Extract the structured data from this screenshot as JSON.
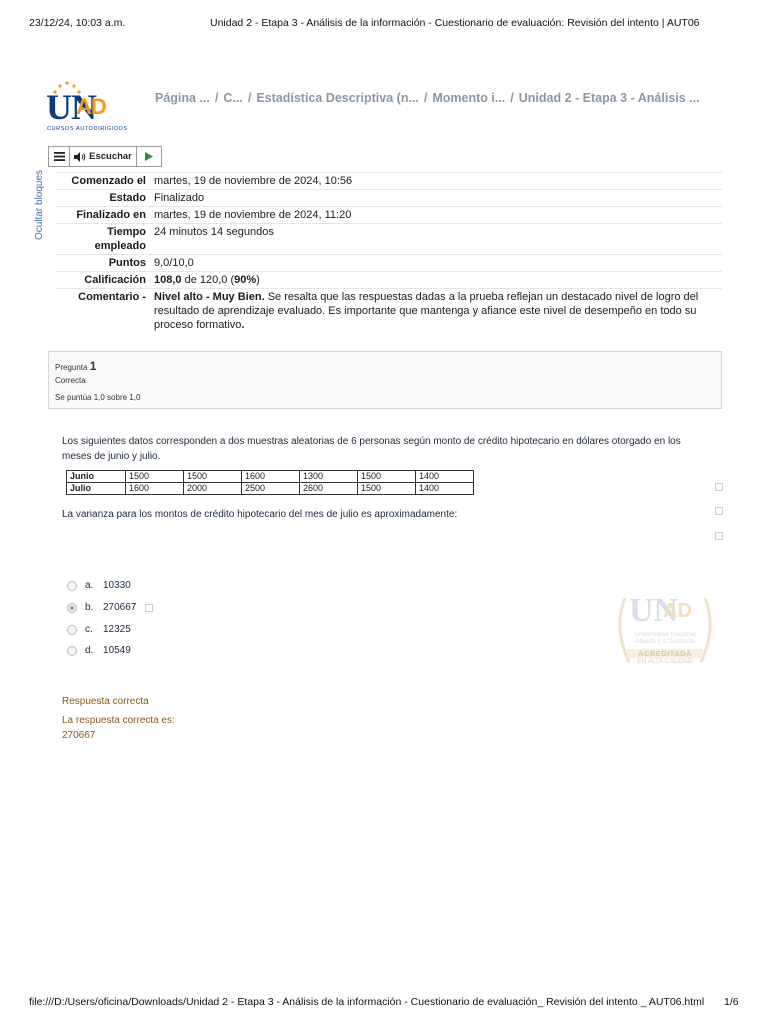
{
  "print_header": {
    "datetime": "23/12/24, 10:03 a.m.",
    "title": "Unidad 2 - Etapa 3 - Análisis de la información - Cuestionario de evaluación: Revisión del intento | AUT06"
  },
  "logo": {
    "mark_main": "UN",
    "mark_accent": "AD",
    "tagline": "CURSOS AUTODIRIGIDOS"
  },
  "breadcrumb": {
    "separator": "/",
    "items": [
      "Página ...",
      "C...",
      "Estadística Descriptiva (n...",
      "Momento i...",
      "Unidad 2 - Etapa 3 - Análisis ..."
    ]
  },
  "toolbar": {
    "menu_icon": "menu-icon",
    "listen_label": "Escuchar",
    "speaker_icon": "speaker-icon",
    "play_icon": "play-icon"
  },
  "side_label": "Ocultar bloques",
  "summary": {
    "started_label": "Comenzado el",
    "started_value": "martes, 19 de noviembre de 2024, 10:56",
    "state_label": "Estado",
    "state_value": "Finalizado",
    "finished_label": "Finalizado en",
    "finished_value": "martes, 19 de noviembre de 2024, 11:20",
    "time_label_1": "Tiempo",
    "time_label_2": "empleado",
    "time_value": "24 minutos 14 segundos",
    "points_label": "Puntos",
    "points_value": "9,0/10,0",
    "grade_label": "Calificación",
    "grade_score": "108,0",
    "grade_of": "de 120,0 (",
    "grade_pct": "90%",
    "grade_close": ")",
    "comment_label": "Comentario -",
    "comment_bold": "Nivel alto - Muy Bien.",
    "comment_text": "Se resalta que las respuestas dadas a la prueba reflejan un destacado nivel de logro del resultado de aprendizaje evaluado. Es importante que mantenga y afiance este nivel de desempeño en todo su proceso formativo",
    "comment_end": "."
  },
  "question": {
    "label": "Pregunta",
    "number": "1",
    "status": "Correcta",
    "score": "Se puntúa 1,0 sobre 1,0",
    "text": "Los siguientes datos corresponden a dos muestras aleatorias de 6 personas según monto de crédito hipotecario en dólares otorgado en los meses de junio y julio.",
    "table": {
      "rows": [
        {
          "label": "Junio",
          "values": [
            "1500",
            "1500",
            "1600",
            "1300",
            "1500",
            "1400"
          ]
        },
        {
          "label": "Julio",
          "values": [
            "1600",
            "2000",
            "2500",
            "2600",
            "1500",
            "1400"
          ]
        }
      ]
    },
    "prompt": "La varianza para los montos de crédito hipotecario del mes de julio es aproximadamente:",
    "options": [
      {
        "letter": "a.",
        "value": "10330",
        "selected": false
      },
      {
        "letter": "b.",
        "value": "270667",
        "selected": true
      },
      {
        "letter": "c.",
        "value": "12325",
        "selected": false
      },
      {
        "letter": "d.",
        "value": "10549",
        "selected": false
      }
    ]
  },
  "watermark": {
    "mark_main": "UN",
    "mark_accent": "AD",
    "line1": "Universidad Nacional",
    "line2": "Abierta y a Distancia",
    "line3": "ACREDITADA",
    "line4": "EN ALTA CALIDAD"
  },
  "feedback": {
    "result": "Respuesta correcta",
    "correct_label": "La respuesta correcta es:",
    "correct_value": "270667"
  },
  "print_footer": {
    "path": "file:///D:/Users/oficina/Downloads/Unidad 2 - Etapa 3 - Análisis de la información - Cuestionario de evaluación_ Revisión del intento _ AUT06.html",
    "page": "1/6"
  },
  "colors": {
    "brand_blue": "#0b3d7c",
    "brand_orange": "#f39a1e",
    "feedback": "#8a5a18",
    "breadcrumb": "#8c97a3"
  }
}
